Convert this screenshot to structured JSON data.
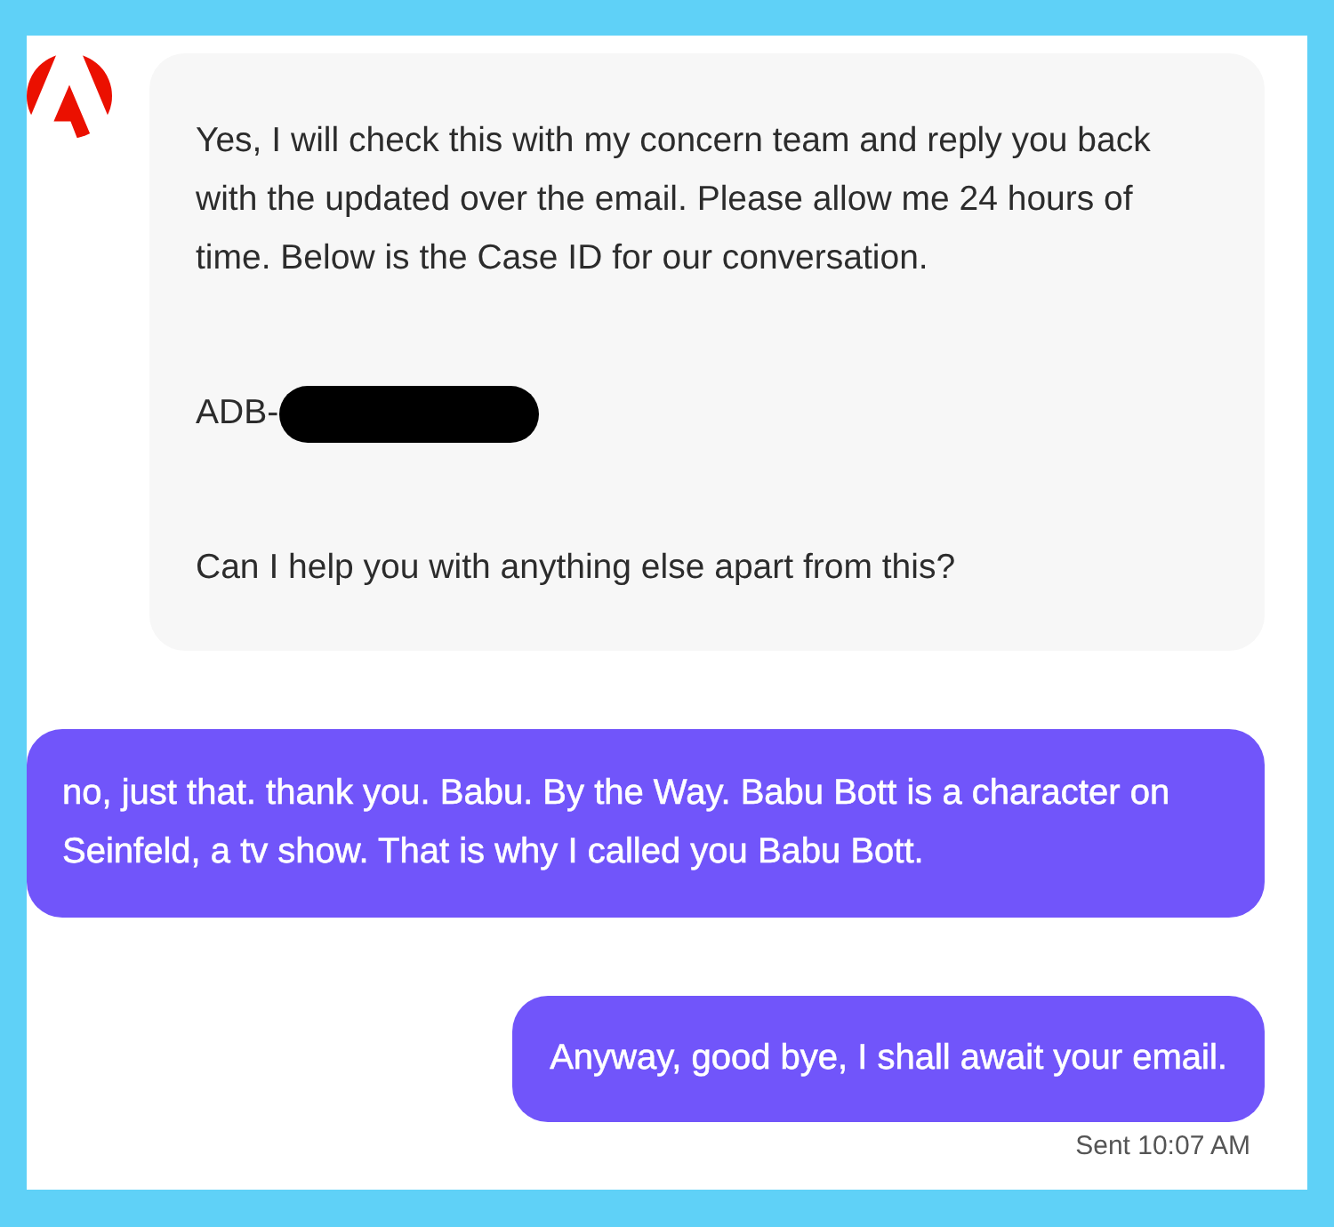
{
  "messages": [
    {
      "kind": "agent",
      "paragraphs": [
        {
          "kind": "text",
          "text": "Yes, I will check this with my concern team and reply you back with the updated over the email. Please allow me 24 hours of time. Below is the Case ID for our conversation."
        },
        {
          "kind": "case_id",
          "text": "ADB-",
          "redacted": true
        },
        {
          "kind": "text",
          "text": "Can I help you with anything else apart from this?"
        }
      ]
    },
    {
      "kind": "user",
      "text": "no, just that. thank you. Babu. By the Way. Babu Bott is a character on Seinfeld, a tv show. That is why I called you Babu Bott."
    },
    {
      "kind": "user",
      "text": "Anyway, good bye, I shall await your email.",
      "status": "Sent 10:07 AM"
    }
  ]
}
